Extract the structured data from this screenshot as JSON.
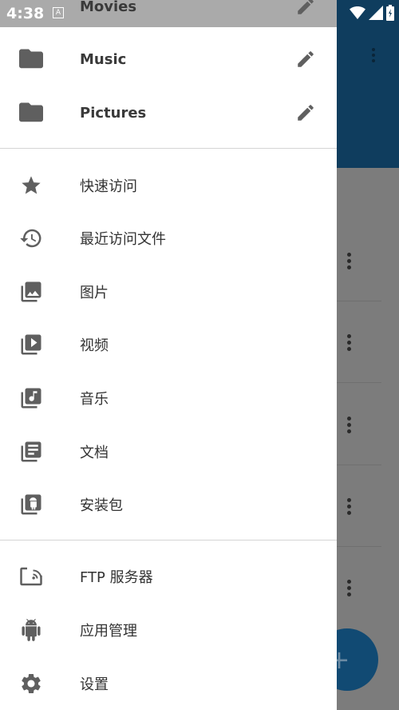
{
  "status": {
    "time": "4:38",
    "notif": "A"
  },
  "bookmarks": [
    {
      "label": "Movies"
    },
    {
      "label": "Music"
    },
    {
      "label": "Pictures"
    }
  ],
  "library": [
    {
      "label": "快速访问",
      "icon": "star-icon"
    },
    {
      "label": "最近访问文件",
      "icon": "history-icon"
    },
    {
      "label": "图片",
      "icon": "images-icon"
    },
    {
      "label": "视频",
      "icon": "video-icon"
    },
    {
      "label": "音乐",
      "icon": "music-icon"
    },
    {
      "label": "文档",
      "icon": "document-icon"
    },
    {
      "label": "安装包",
      "icon": "apk-icon"
    }
  ],
  "tools": [
    {
      "label": "FTP 服务器",
      "icon": "ftp-icon"
    },
    {
      "label": "应用管理",
      "icon": "android-icon"
    },
    {
      "label": "设置",
      "icon": "gear-icon"
    }
  ],
  "fab": {
    "label": "+"
  },
  "colors": {
    "appbar": "#0f3d5e",
    "icon": "#5f5f5f",
    "fab": "#114a73"
  }
}
